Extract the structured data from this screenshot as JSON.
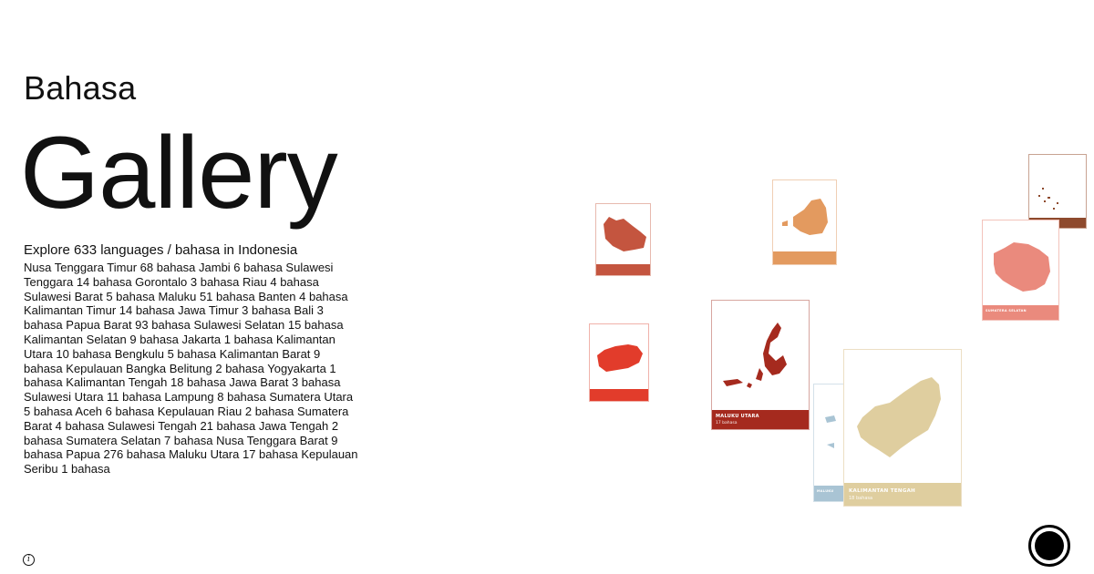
{
  "header": {
    "kicker": "Bahasa",
    "title": "Gallery"
  },
  "intro": "Explore 633 languages / bahasa in Indonesia",
  "provinces": [
    "Nusa Tenggara Timur 68 bahasa",
    "Jambi 6 bahasa",
    "Sulawesi Tenggara 14 bahasa",
    "Gorontalo 3 bahasa",
    "Riau 4 bahasa",
    "Sulawesi Barat 5 bahasa",
    "Maluku 51 bahasa",
    "Banten 4 bahasa",
    "Kalimantan Timur 14 bahasa",
    "Jawa Timur 3 bahasa",
    "Bali 3 bahasa",
    "Papua Barat 93 bahasa",
    "Sulawesi Selatan 15 bahasa",
    "Kalimantan Selatan 9 bahasa",
    "Jakarta 1 bahasa",
    "Kalimantan Utara 10 bahasa",
    "Bengkulu 5 bahasa",
    "Kalimantan Barat 9 bahasa",
    "Kepulauan Bangka Belitung 2 bahasa",
    "Yogyakarta 1 bahasa",
    "Kalimantan Tengah 18 bahasa",
    "Jawa Barat 3 bahasa",
    "Sulawesi Utara 11 bahasa",
    "Lampung 8 bahasa",
    "Sumatera Utara 5 bahasa",
    "Aceh 6 bahasa",
    "Kepulauan Riau 2 bahasa",
    "Sumatera Barat 4 bahasa",
    "Sulawesi Tengah 21 bahasa",
    "Jawa Tengah 2 bahasa",
    "Sumatera Selatan 7 bahasa",
    "Nusa Tenggara Barat 9 bahasa",
    "Papua 276 bahasa",
    "Maluku Utara 17 bahasa",
    "Kepulauan Seribu 1 bahasa"
  ],
  "cards": [
    {
      "id": "bali",
      "color": "#c4553f",
      "name": "",
      "count": ""
    },
    {
      "id": "banten",
      "color": "#e39a5f",
      "name": "",
      "count": ""
    },
    {
      "id": "papua-barat-islands",
      "color": "#8e4a2d",
      "name": "",
      "count": ""
    },
    {
      "id": "sumatera-selatan",
      "color": "#ea8a7d",
      "name": "SUMATERA SELATAN",
      "count": ""
    },
    {
      "id": "jambi",
      "color": "#e23c2b",
      "name": "",
      "count": ""
    },
    {
      "id": "maluku-utara",
      "color": "#a52a1e",
      "name": "MALUKU UTARA",
      "count": "17 bahasa"
    },
    {
      "id": "maluku",
      "color": "#a9c4d4",
      "name": "MALUKU",
      "count": ""
    },
    {
      "id": "kalimantan-tengah",
      "color": "#dfce9f",
      "name": "KALIMANTAN TENGAH",
      "count": "18 bahasa"
    }
  ],
  "icons": {
    "info": "info-icon",
    "record": "record-icon"
  }
}
